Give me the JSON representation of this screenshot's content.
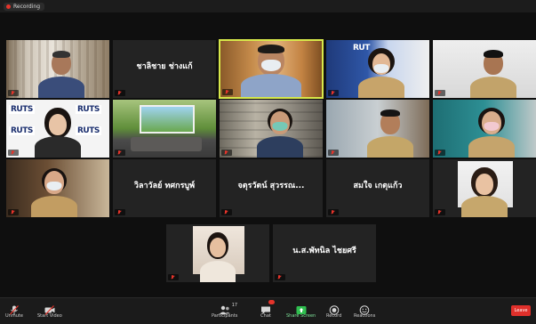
{
  "recording": {
    "label": "Recording"
  },
  "tiles": [
    {
      "id": "t1",
      "caption": "",
      "name_only": ""
    },
    {
      "id": "t2",
      "caption": "",
      "name_only": "ชาลิชาย ช่างแก้"
    },
    {
      "id": "t3",
      "caption": "",
      "name_only": ""
    },
    {
      "id": "t4",
      "caption": "",
      "name_only": ""
    },
    {
      "id": "t5",
      "caption": "",
      "name_only": ""
    },
    {
      "id": "t6",
      "caption": "",
      "name_only": ""
    },
    {
      "id": "t7",
      "caption": "",
      "name_only": ""
    },
    {
      "id": "t8",
      "caption": "",
      "name_only": ""
    },
    {
      "id": "t9",
      "caption": "",
      "name_only": ""
    },
    {
      "id": "t10",
      "caption": "",
      "name_only": ""
    },
    {
      "id": "t11",
      "caption": "",
      "name_only": ""
    },
    {
      "id": "t12",
      "caption": "",
      "name_only": "วิลาวัลย์ ทศกรบูพ์"
    },
    {
      "id": "t13",
      "caption": "",
      "name_only": "จตุรวัตน์ สุวรรณ..."
    },
    {
      "id": "t14",
      "caption": "",
      "name_only": "สมใจ เกตุแก้ว"
    },
    {
      "id": "t15",
      "caption": "",
      "name_only": ""
    },
    {
      "id": "t16",
      "caption": "",
      "name_only": ""
    },
    {
      "id": "t17",
      "caption": "",
      "name_only": "น.ส.พัทนิล ไชยศรี"
    }
  ],
  "logos": {
    "brand": "RUTS",
    "brand_small": "RUT"
  },
  "toolbar": {
    "unmute": "Unmute",
    "start_video": "Start Video",
    "participants": "Participants",
    "participants_count": "17",
    "chat": "Chat",
    "share_screen": "Share Screen",
    "record": "Record",
    "reactions": "Reactions",
    "end": "Leave"
  },
  "colors": {
    "active_speaker": "#d7e84a",
    "share": "#2fbf4f",
    "end": "#e0302b"
  }
}
